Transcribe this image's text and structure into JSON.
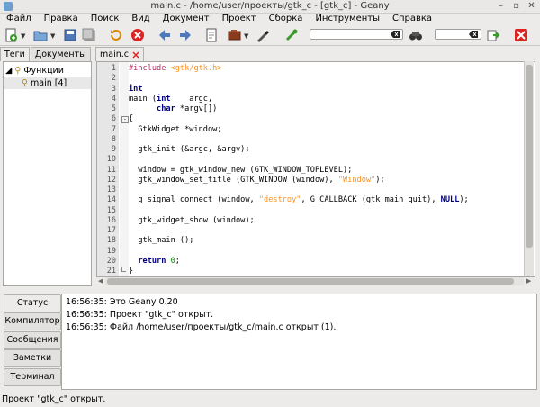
{
  "window": {
    "title": "main.c - /home/user/проекты/gtk_c - [gtk_c] - Geany"
  },
  "menu": [
    "Файл",
    "Правка",
    "Поиск",
    "Вид",
    "Документ",
    "Проект",
    "Сборка",
    "Инструменты",
    "Справка"
  ],
  "toolbar": {
    "search_value": "",
    "goto_value": "",
    "icons": [
      "new-file-icon",
      "dropdown-arrow-icon",
      "open-file-icon",
      "dropdown-arrow-icon",
      "save-icon",
      "save-all-icon",
      "revert-icon",
      "close-icon",
      "back-icon",
      "forward-icon",
      "compile-icon",
      "build-icon",
      "build-dropdown-icon",
      "color-picker-icon",
      "run-icon",
      "clear-icon",
      "search-icon",
      "clear-icon",
      "jump-icon",
      "quit-icon"
    ]
  },
  "sidebar": {
    "tabs": [
      "Теги",
      "Документы"
    ],
    "active_tab": "Теги",
    "tree": {
      "root": "Функции",
      "child": "main [4]"
    }
  },
  "editor": {
    "tab_label": "main.c",
    "line_numbers": [
      "1",
      "2",
      "3",
      "4",
      "5",
      "6",
      "7",
      "8",
      "9",
      "10",
      "11",
      "12",
      "13",
      "14",
      "15",
      "16",
      "17",
      "18",
      "19",
      "20",
      "21"
    ]
  },
  "messages": {
    "tabs": [
      "Статус",
      "Компилятор",
      "Сообщения",
      "Заметки",
      "Терминал"
    ],
    "active_tab": "Статус",
    "lines": [
      "16:56:35: Это Geany 0.20",
      "16:56:35: Проект \"gtk_c\" открыт.",
      "16:56:35: Файл /home/user/проекты/gtk_c/main.c открыт (1)."
    ]
  },
  "status": {
    "text": "Проект \"gtk_c\" открыт."
  },
  "colors": {
    "keyword": "#00007f",
    "preprocessor": "#b03060",
    "string": "#ff901e",
    "number": "#007f00"
  }
}
